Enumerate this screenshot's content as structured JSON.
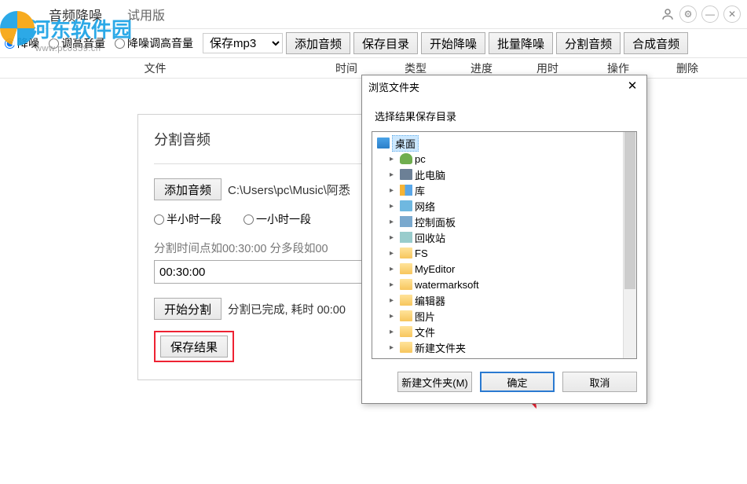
{
  "titlebar": {
    "app_name": "音频降噪",
    "trial": "试用版"
  },
  "watermark": {
    "text": "河东软件园",
    "url": "www.pc0359.cn"
  },
  "toolbar": {
    "radios": {
      "r1": "降噪",
      "r2": "调高音量",
      "r3": "降噪调高音量"
    },
    "save_select": "保存mp3",
    "btns": [
      "添加音频",
      "保存目录",
      "开始降噪",
      "批量降噪",
      "分割音频",
      "合成音频"
    ]
  },
  "columns": [
    "文件",
    "时间",
    "类型",
    "进度",
    "用时",
    "操作",
    "删除"
  ],
  "panel": {
    "title": "分割音频",
    "add_btn": "添加音频",
    "path": "C:\\Users\\pc\\Music\\阿悉",
    "seg1": "半小时一段",
    "seg2": "一小时一段",
    "hint": "分割时间点如00:30:00 分多段如00",
    "time_value": "00:30:00",
    "start_btn": "开始分割",
    "status": "分割已完成, 耗时 00:00",
    "save_btn": "保存结果"
  },
  "dialog": {
    "title": "浏览文件夹",
    "instruction": "选择结果保存目录",
    "tree": {
      "desktop": "桌面",
      "items": [
        {
          "label": "pc",
          "icon": "user"
        },
        {
          "label": "此电脑",
          "icon": "pc"
        },
        {
          "label": "库",
          "icon": "lib"
        },
        {
          "label": "网络",
          "icon": "net"
        },
        {
          "label": "控制面板",
          "icon": "cpl"
        },
        {
          "label": "回收站",
          "icon": "recycle"
        },
        {
          "label": "FS",
          "icon": "folder"
        },
        {
          "label": "MyEditor",
          "icon": "folder"
        },
        {
          "label": "watermarksoft",
          "icon": "folder"
        },
        {
          "label": "编辑器",
          "icon": "folder"
        },
        {
          "label": "图片",
          "icon": "folder"
        },
        {
          "label": "文件",
          "icon": "folder"
        },
        {
          "label": "新建文件夹",
          "icon": "folder"
        }
      ]
    },
    "new_folder": "新建文件夹(M)",
    "ok": "确定",
    "cancel": "取消"
  }
}
